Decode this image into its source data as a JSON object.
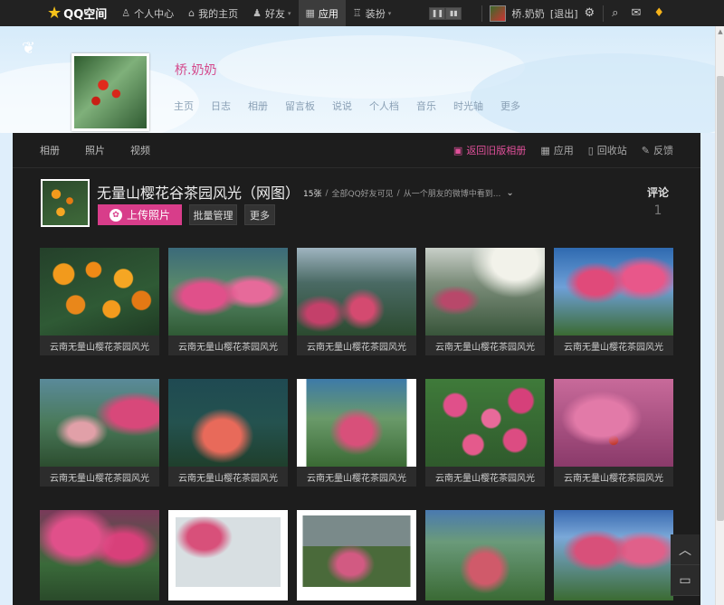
{
  "topbar": {
    "logo_text": "QQ空间",
    "nav": [
      {
        "label": "个人中心",
        "icon": "person-icon"
      },
      {
        "label": "我的主页",
        "icon": "home-icon"
      },
      {
        "label": "好友",
        "icon": "friends-icon"
      },
      {
        "label": "应用",
        "icon": "apps-grid-icon"
      },
      {
        "label": "装扮",
        "icon": "shirt-icon"
      }
    ],
    "user_name": "桥.奶奶",
    "logout_label": "[退出]"
  },
  "profile": {
    "name": "桥.奶奶",
    "nav": [
      "主页",
      "日志",
      "相册",
      "留言板",
      "说说",
      "个人档",
      "音乐",
      "时光轴",
      "更多"
    ]
  },
  "subnav": {
    "left": [
      "相册",
      "照片",
      "视频"
    ],
    "right": [
      {
        "label": "返回旧版相册",
        "icon": "image-icon"
      },
      {
        "label": "应用",
        "icon": "apps-grid-icon"
      },
      {
        "label": "回收站",
        "icon": "trash-icon"
      },
      {
        "label": "反馈",
        "icon": "edit-icon"
      }
    ]
  },
  "album": {
    "title": "无量山樱花谷茶园风光（网图）",
    "count": "15张",
    "visibility": "全部QQ好友可见",
    "source": "从一个朋友的微博中看到...",
    "upload_label": "上传照片",
    "manage_label": "批量管理",
    "more_label": "更多",
    "comments_label": "评论",
    "comments_count": "1"
  },
  "photos": [
    {
      "caption": "云南无量山樱花茶园风光"
    },
    {
      "caption": "云南无量山樱花茶园风光"
    },
    {
      "caption": "云南无量山樱花茶园风光"
    },
    {
      "caption": "云南无量山樱花茶园风光"
    },
    {
      "caption": "云南无量山樱花茶园风光"
    },
    {
      "caption": "云南无量山樱花茶园风光"
    },
    {
      "caption": "云南无量山樱花茶园风光"
    },
    {
      "caption": "云南无量山樱花茶园风光"
    },
    {
      "caption": "云南无量山樱花茶园风光"
    },
    {
      "caption": "云南无量山樱花茶园风光"
    },
    {
      "caption": ""
    },
    {
      "caption": ""
    },
    {
      "caption": ""
    },
    {
      "caption": ""
    },
    {
      "caption": ""
    }
  ]
}
